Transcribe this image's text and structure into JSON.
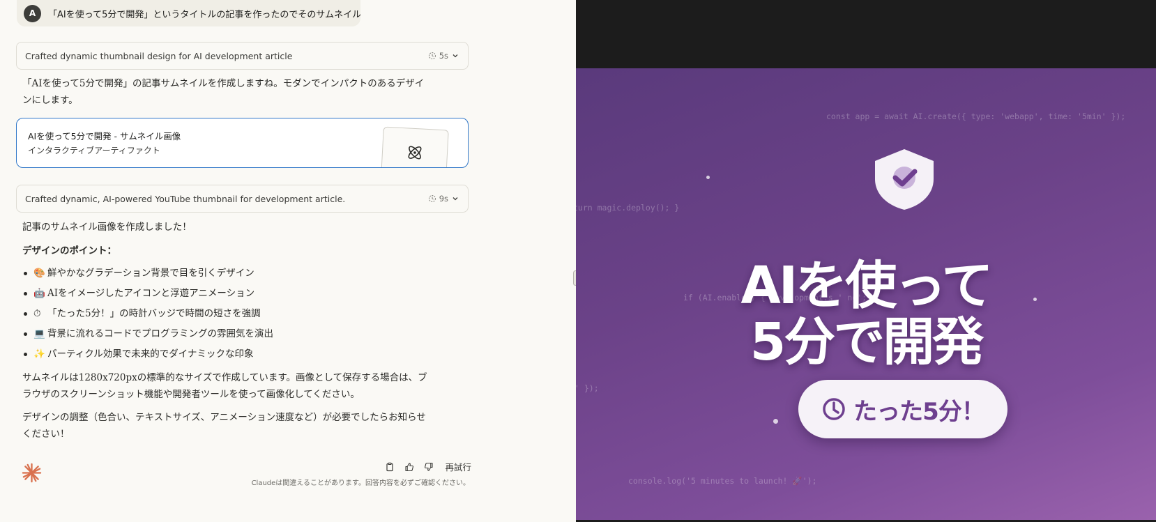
{
  "chat": {
    "user_avatar": "A",
    "user_message": "「AIを使って5分で開発」というタイトルの記事を作ったのでそのサムネイル画像を作って",
    "thinking_1": {
      "label": "Crafted dynamic thumbnail design for AI development article",
      "time": "5s"
    },
    "intro": "「AIを使って5分で開発」の記事サムネイルを作成しますね。モダンでインパクトのあるデザインにします。",
    "intro_line1": "「AIを使って5分で開発」の記事サムネイルを作成しますね。モダンでインパクトのあるデザイ",
    "intro_line2": "ンにします。",
    "artifact": {
      "title": "AIを使って5分で開発 - サムネイル画像",
      "subtitle": "インタラクティブアーティファクト"
    },
    "thinking_2": {
      "label": "Crafted dynamic, AI-powered YouTube thumbnail for development article.",
      "time": "9s"
    },
    "done": "記事のサムネイル画像を作成しました！",
    "points_heading": "デザインのポイント：",
    "points": [
      {
        "emoji": "🎨",
        "text": "鮮やかなグラデーション背景で目を引くデザイン"
      },
      {
        "emoji": "🤖",
        "text": "AIをイメージしたアイコンと浮遊アニメーション"
      },
      {
        "emoji": "⏱",
        "text": "「たった5分！」の時計バッジで時間の短さを強調"
      },
      {
        "emoji": "💻",
        "text": "背景に流れるコードでプログラミングの雰囲気を演出"
      },
      {
        "emoji": "✨",
        "text": "パーティクル効果で未来的でダイナミックな印象"
      }
    ],
    "size_note_line1": "サムネイルは1280x720pxの標準的なサイズで作成しています。画像として保存する場合は、ブ",
    "size_note_line2": "ラウザのスクリーンショット機能や開発者ツールを使って画像化してください。",
    "adjust_line1": "デザインの調整（色合い、テキストサイズ、アニメーション速度など）が必要でしたらお知らせ",
    "adjust_line2": "ください！",
    "retry_label": "再試行",
    "disclaimer": "Claudeは間違えることがあります。回答内容を必ずご確認ください。",
    "icons": [
      "copy-icon",
      "thumbs-up-icon",
      "thumbs-down-icon",
      "clock-icon",
      "chevron-down-icon",
      "atom-icon",
      "claude-logo"
    ]
  },
  "preview": {
    "colors": {
      "gradient_start": "#5a3a7c",
      "gradient_end": "#9a62ad",
      "badge_bg": "#f6f2f8",
      "badge_text": "#6e3f8f"
    },
    "code_lines": [
      "const app = await AI.create({ type: 'webapp', time: '5min' });",
      "turn magic.deploy(); }",
      "if (AI.enabled) { development.s      '        ng';",
      "' });",
      "console.log('5 minutes to launch! 🚀');"
    ],
    "headline_line1": "AIを使って",
    "headline_line2": "5分で開発",
    "badge_text": "たった5分！"
  }
}
